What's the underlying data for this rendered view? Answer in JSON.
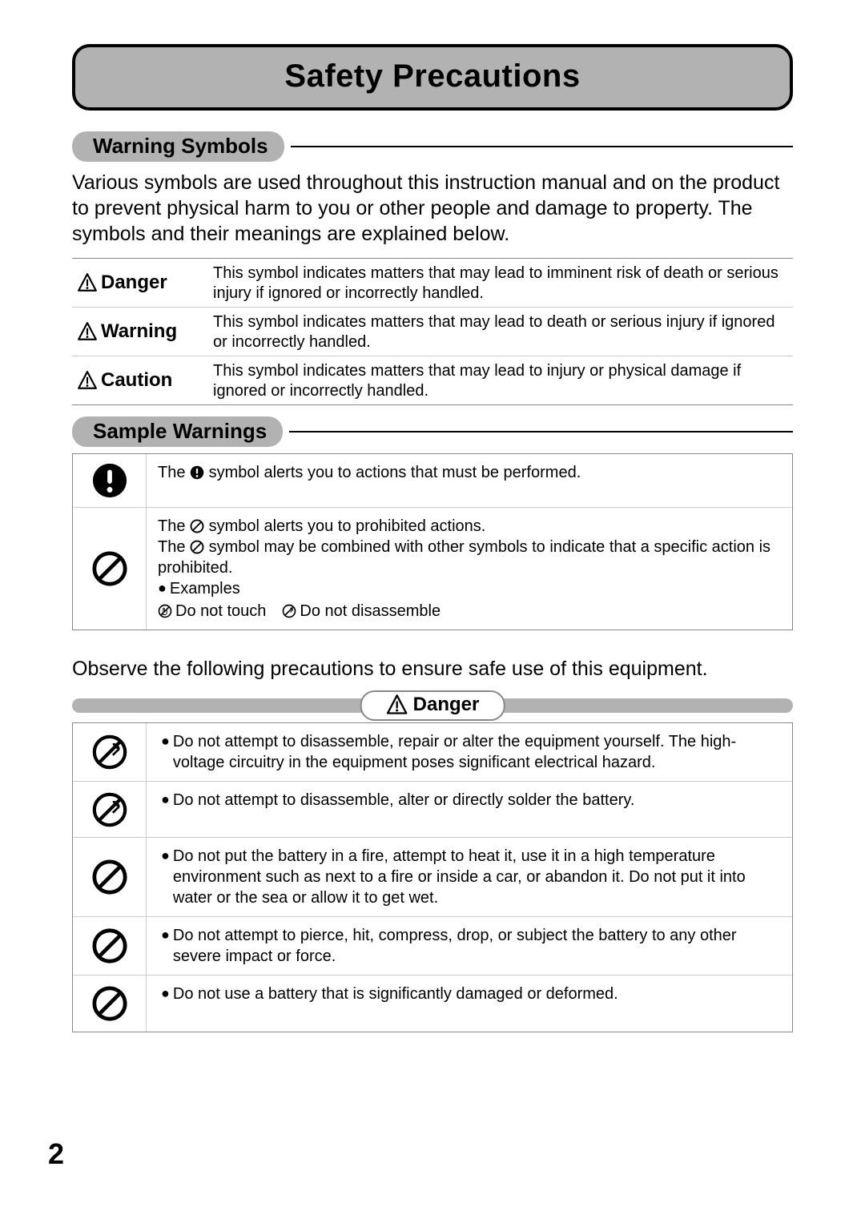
{
  "title": "Safety Precautions",
  "section1": {
    "heading": "Warning Symbols",
    "intro": "Various symbols are used throughout this instruction manual and on the product to prevent physical harm to you or other people and damage to property. The symbols and their meanings are explained below."
  },
  "definitions": [
    {
      "label": "Danger",
      "text": "This symbol indicates matters that may lead to imminent risk of death or serious injury if ignored or incorrectly handled."
    },
    {
      "label": "Warning",
      "text": "This symbol indicates matters that may lead to death or serious injury if ignored or incorrectly handled."
    },
    {
      "label": "Caution",
      "text": "This symbol indicates matters that may lead to injury or physical damage if ignored or incorrectly handled."
    }
  ],
  "section2": {
    "heading": "Sample Warnings"
  },
  "samples": {
    "mandatory_pre": "The ",
    "mandatory_post": " symbol alerts you to actions that must be performed.",
    "prohibit_l1_pre": "The ",
    "prohibit_l1_post": " symbol alerts you to prohibited actions.",
    "prohibit_l2_pre": "The ",
    "prohibit_l2_post": " symbol may be combined with other symbols to indicate that a specific action is prohibited.",
    "examples_label": "Examples",
    "ex1": " Do not touch",
    "ex2": " Do not disassemble"
  },
  "observe": "Observe the following precautions to ensure safe use of this equipment.",
  "danger_heading": "Danger",
  "danger_items": [
    {
      "icon": "no-disassemble",
      "text": "Do not attempt to disassemble, repair or alter the equipment yourself. The high-voltage circuitry in the equipment poses significant electrical hazard."
    },
    {
      "icon": "no-disassemble",
      "text": "Do not attempt to disassemble, alter or directly solder the battery."
    },
    {
      "icon": "prohibit",
      "text": "Do not put the battery in a fire, attempt to heat it, use it in a high temperature environment such as next to a fire or inside a car, or abandon it. Do not put it into water or the sea or allow it to get wet."
    },
    {
      "icon": "prohibit",
      "text": "Do not attempt to pierce, hit, compress, drop, or subject the battery to any other severe impact or force."
    },
    {
      "icon": "prohibit",
      "text": "Do not use a battery that is significantly damaged or deformed."
    }
  ],
  "page_number": "2"
}
